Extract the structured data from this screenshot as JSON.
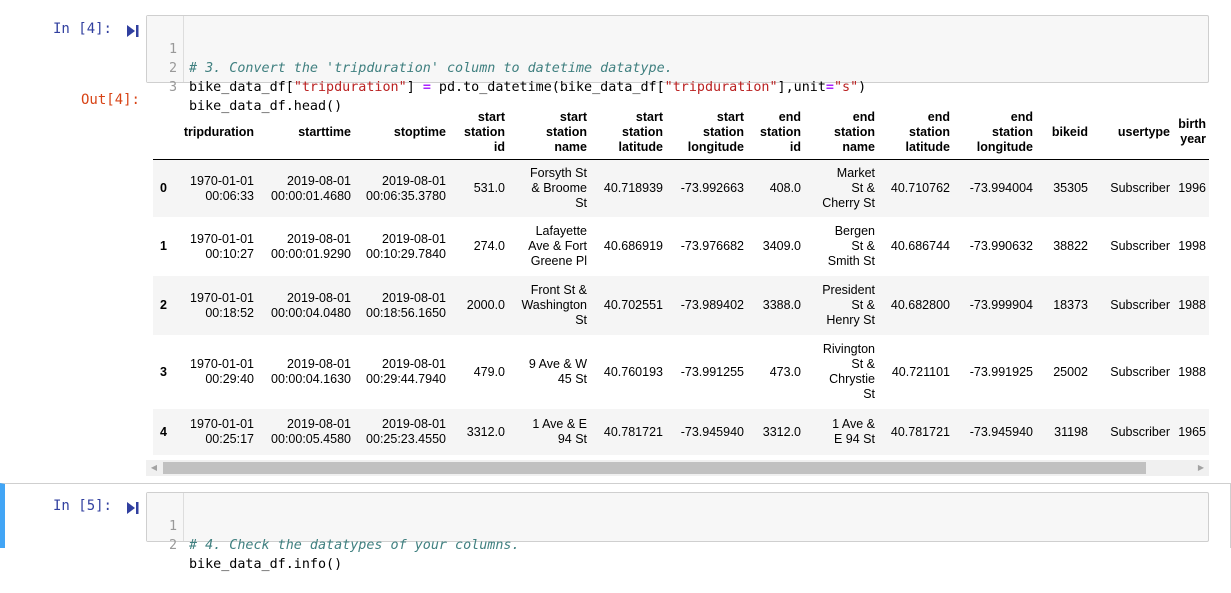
{
  "cell4": {
    "in_prompt": "In [4]:",
    "out_prompt": "Out[4]:",
    "lines": [
      {
        "num": "1",
        "comment": "# 3. Convert the 'tripduration' column to datetime datatype."
      },
      {
        "num": "2",
        "p1": "bike_data_df[",
        "s1": "\"tripduration\"",
        "p2": "] ",
        "op1": "=",
        "p3": " pd.to_datetime(bike_data_df[",
        "s2": "\"tripduration\"",
        "p4": "],unit",
        "op2": "=",
        "s3": "\"s\"",
        "p5": ")"
      },
      {
        "num": "3",
        "code": "bike_data_df.head()"
      }
    ]
  },
  "cell5": {
    "in_prompt": "In [5]:",
    "lines": [
      {
        "num": "1",
        "comment": "# 4. Check the datatypes of your columns."
      },
      {
        "num": "2",
        "code": "bike_data_df.info()"
      }
    ]
  },
  "dataframe": {
    "columns": [
      [
        "tripduration"
      ],
      [
        "starttime"
      ],
      [
        "stoptime"
      ],
      [
        "start",
        "station",
        "id"
      ],
      [
        "start",
        "station",
        "name"
      ],
      [
        "start",
        "station",
        "latitude"
      ],
      [
        "start",
        "station",
        "longitude"
      ],
      [
        "end",
        "station",
        "id"
      ],
      [
        "end",
        "station",
        "name"
      ],
      [
        "end",
        "station",
        "latitude"
      ],
      [
        "end",
        "station",
        "longitude"
      ],
      [
        "bikeid"
      ],
      [
        "usertype"
      ],
      [
        "birth",
        "year"
      ]
    ],
    "rows": [
      {
        "index": "0",
        "cells": [
          [
            "1970-01-01",
            "00:06:33"
          ],
          [
            "2019-08-01",
            "00:00:01.4680"
          ],
          [
            "2019-08-01",
            "00:06:35.3780"
          ],
          [
            "531.0"
          ],
          [
            "Forsyth St",
            "& Broome",
            "St"
          ],
          [
            "40.718939"
          ],
          [
            "-73.992663"
          ],
          [
            "408.0"
          ],
          [
            "Market",
            "St &",
            "Cherry St"
          ],
          [
            "40.710762"
          ],
          [
            "-73.994004"
          ],
          [
            "35305"
          ],
          [
            "Subscriber"
          ],
          [
            "1996"
          ]
        ]
      },
      {
        "index": "1",
        "cells": [
          [
            "1970-01-01",
            "00:10:27"
          ],
          [
            "2019-08-01",
            "00:00:01.9290"
          ],
          [
            "2019-08-01",
            "00:10:29.7840"
          ],
          [
            "274.0"
          ],
          [
            "Lafayette",
            "Ave & Fort",
            "Greene Pl"
          ],
          [
            "40.686919"
          ],
          [
            "-73.976682"
          ],
          [
            "3409.0"
          ],
          [
            "Bergen",
            "St &",
            "Smith St"
          ],
          [
            "40.686744"
          ],
          [
            "-73.990632"
          ],
          [
            "38822"
          ],
          [
            "Subscriber"
          ],
          [
            "1998"
          ]
        ]
      },
      {
        "index": "2",
        "cells": [
          [
            "1970-01-01",
            "00:18:52"
          ],
          [
            "2019-08-01",
            "00:00:04.0480"
          ],
          [
            "2019-08-01",
            "00:18:56.1650"
          ],
          [
            "2000.0"
          ],
          [
            "Front St &",
            "Washington",
            "St"
          ],
          [
            "40.702551"
          ],
          [
            "-73.989402"
          ],
          [
            "3388.0"
          ],
          [
            "President",
            "St &",
            "Henry St"
          ],
          [
            "40.682800"
          ],
          [
            "-73.999904"
          ],
          [
            "18373"
          ],
          [
            "Subscriber"
          ],
          [
            "1988"
          ]
        ]
      },
      {
        "index": "3",
        "cells": [
          [
            "1970-01-01",
            "00:29:40"
          ],
          [
            "2019-08-01",
            "00:00:04.1630"
          ],
          [
            "2019-08-01",
            "00:29:44.7940"
          ],
          [
            "479.0"
          ],
          [
            "9 Ave & W",
            "45 St"
          ],
          [
            "40.760193"
          ],
          [
            "-73.991255"
          ],
          [
            "473.0"
          ],
          [
            "Rivington",
            "St &",
            "Chrystie",
            "St"
          ],
          [
            "40.721101"
          ],
          [
            "-73.991925"
          ],
          [
            "25002"
          ],
          [
            "Subscriber"
          ],
          [
            "1988"
          ]
        ]
      },
      {
        "index": "4",
        "cells": [
          [
            "1970-01-01",
            "00:25:17"
          ],
          [
            "2019-08-01",
            "00:00:05.4580"
          ],
          [
            "2019-08-01",
            "00:25:23.4550"
          ],
          [
            "3312.0"
          ],
          [
            "1 Ave & E",
            "94 St"
          ],
          [
            "40.781721"
          ],
          [
            "-73.945940"
          ],
          [
            "3312.0"
          ],
          [
            "1 Ave &",
            "E 94 St"
          ],
          [
            "40.781721"
          ],
          [
            "-73.945940"
          ],
          [
            "31198"
          ],
          [
            "Subscriber"
          ],
          [
            "1965"
          ]
        ]
      }
    ]
  },
  "scrollbar": {
    "left_arrow": "◀",
    "right_arrow": "▶"
  },
  "icons": {
    "run": "run-cell-icon"
  }
}
